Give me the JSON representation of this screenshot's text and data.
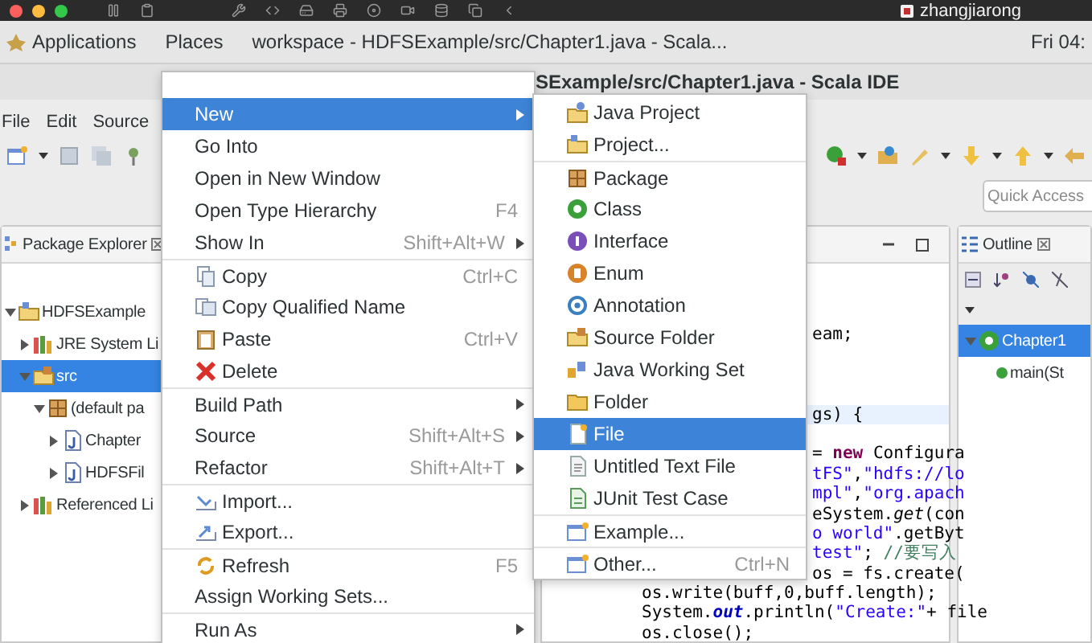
{
  "system_bar": {
    "user": "zhangjiarong"
  },
  "top_bar": {
    "applications": "Applications",
    "places": "Places",
    "window_title": "workspace - HDFSExample/src/Chapter1.java - Scala...",
    "clock": "Fri 04:"
  },
  "window": {
    "title": "SExample/src/Chapter1.java - Scala IDE"
  },
  "menu_bar": [
    "File",
    "Edit",
    "Source"
  ],
  "quick_access": {
    "placeholder": "Quick Access"
  },
  "package_explorer": {
    "title": "Package Explorer",
    "tree": [
      {
        "label": "HDFSExample",
        "kind": "project",
        "expanded": true,
        "selected": false,
        "children": [
          {
            "label": "JRE System Li",
            "kind": "library",
            "expanded": false,
            "selected": false
          },
          {
            "label": "src",
            "kind": "sourcefolder",
            "expanded": true,
            "selected": true,
            "children": [
              {
                "label": "(default pa",
                "kind": "package",
                "expanded": true,
                "selected": false,
                "children": [
                  {
                    "label": "Chapter",
                    "kind": "javafile",
                    "expanded": false,
                    "selected": false
                  },
                  {
                    "label": "HDFSFil",
                    "kind": "javafile",
                    "expanded": false,
                    "selected": false
                  }
                ]
              }
            ]
          },
          {
            "label": "Referenced Li",
            "kind": "library",
            "expanded": false,
            "selected": false
          }
        ]
      }
    ]
  },
  "editor": {
    "lines": [
      {
        "kind": "partial",
        "current": false,
        "segments": [
          {
            "kind": "plain",
            "text": "eam;"
          }
        ]
      },
      {
        "kind": "blank",
        "current": false
      },
      {
        "kind": "blank",
        "current": false
      },
      {
        "kind": "blank",
        "current": false
      },
      {
        "kind": "partial",
        "current": true,
        "segments": [
          {
            "kind": "plain",
            "text": "gs) {"
          }
        ]
      },
      {
        "kind": "blank",
        "current": false
      },
      {
        "kind": "partial",
        "current": false,
        "segments": [
          {
            "kind": "plain",
            "text": "= "
          },
          {
            "kind": "keyword",
            "text": "new"
          },
          {
            "kind": "plain",
            "text": " Configura"
          }
        ]
      },
      {
        "kind": "partial",
        "current": false,
        "segments": [
          {
            "kind": "string",
            "text": "tFS\""
          },
          {
            "kind": "plain",
            "text": ","
          },
          {
            "kind": "string",
            "text": "\"hdfs://lo"
          }
        ]
      },
      {
        "kind": "partial",
        "current": false,
        "segments": [
          {
            "kind": "string",
            "text": "mpl\""
          },
          {
            "kind": "plain",
            "text": ","
          },
          {
            "kind": "string",
            "text": "\"org.apach"
          }
        ]
      },
      {
        "kind": "partial",
        "current": false,
        "segments": [
          {
            "kind": "plain",
            "text": "eSystem."
          },
          {
            "kind": "static",
            "text": "get"
          },
          {
            "kind": "plain",
            "text": "(con"
          }
        ]
      },
      {
        "kind": "partial",
        "current": false,
        "segments": [
          {
            "kind": "string",
            "text": "o world\""
          },
          {
            "kind": "plain",
            "text": ".getByt"
          }
        ]
      },
      {
        "kind": "partial",
        "current": false,
        "segments": [
          {
            "kind": "string",
            "text": "test\""
          },
          {
            "kind": "plain",
            "text": "; "
          },
          {
            "kind": "comment",
            "text": "//要写入"
          }
        ]
      },
      {
        "kind": "partial",
        "current": false,
        "segments": [
          {
            "kind": "plain",
            "text": "os = fs.create("
          }
        ]
      },
      {
        "kind": "full",
        "current": false,
        "segments": [
          {
            "kind": "plain",
            "text": "os.write(buff,0,buff.length);"
          }
        ]
      },
      {
        "kind": "full",
        "current": false,
        "segments": [
          {
            "kind": "plain",
            "text": "System."
          },
          {
            "kind": "field",
            "text": "out"
          },
          {
            "kind": "plain",
            "text": ".println("
          },
          {
            "kind": "string",
            "text": "\"Create:\""
          },
          {
            "kind": "plain",
            "text": "+ file"
          }
        ]
      },
      {
        "kind": "full",
        "current": false,
        "segments": [
          {
            "kind": "plain",
            "text": "os.close();"
          }
        ]
      }
    ]
  },
  "outline": {
    "title": "Outline",
    "tree": [
      {
        "label": "Chapter1",
        "kind": "class",
        "expanded": true,
        "selected": true,
        "children": [
          {
            "label": "main(St",
            "kind": "method",
            "selected": false
          }
        ]
      }
    ]
  },
  "context_menu": {
    "items": [
      {
        "label": "New",
        "kind": "plain",
        "submenu": true,
        "selected": true
      },
      {
        "label": "Go Into",
        "kind": "plain",
        "selected": false
      },
      {
        "label": "Open in New Window",
        "kind": "plain",
        "selected": false
      },
      {
        "label": "Open Type Hierarchy",
        "kind": "plain",
        "shortcut": "F4",
        "selected": false
      },
      {
        "label": "Show In",
        "kind": "plain",
        "shortcut": "Shift+Alt+W",
        "submenu": true,
        "selected": false
      },
      {
        "label": "Copy",
        "kind": "copy",
        "shortcut": "Ctrl+C",
        "separator_before": true,
        "selected": false
      },
      {
        "label": "Copy Qualified Name",
        "kind": "copyname",
        "selected": false
      },
      {
        "label": "Paste",
        "kind": "paste",
        "shortcut": "Ctrl+V",
        "selected": false
      },
      {
        "label": "Delete",
        "kind": "delete",
        "selected": false
      },
      {
        "label": "Build Path",
        "kind": "plain",
        "submenu": true,
        "separator_before": true,
        "selected": false
      },
      {
        "label": "Source",
        "kind": "plain",
        "shortcut": "Shift+Alt+S",
        "submenu": true,
        "selected": false
      },
      {
        "label": "Refactor",
        "kind": "plain",
        "shortcut": "Shift+Alt+T",
        "submenu": true,
        "selected": false
      },
      {
        "label": "Import...",
        "kind": "import",
        "separator_before": true,
        "selected": false
      },
      {
        "label": "Export...",
        "kind": "export",
        "selected": false
      },
      {
        "label": "Refresh",
        "kind": "refresh",
        "shortcut": "F5",
        "separator_before": true,
        "selected": false
      },
      {
        "label": "Assign Working Sets...",
        "kind": "plain",
        "selected": false
      },
      {
        "label": "Run As",
        "kind": "plain",
        "submenu": true,
        "separator_before": true,
        "selected": false
      }
    ]
  },
  "new_submenu": {
    "items": [
      {
        "label": "Java Project",
        "kind": "javaproject",
        "selected": false
      },
      {
        "label": "Project...",
        "kind": "project",
        "selected": false
      },
      {
        "label": "Package",
        "kind": "package",
        "separator_before": true,
        "selected": false
      },
      {
        "label": "Class",
        "kind": "class",
        "selected": false
      },
      {
        "label": "Interface",
        "kind": "interface",
        "selected": false
      },
      {
        "label": "Enum",
        "kind": "enum",
        "selected": false
      },
      {
        "label": "Annotation",
        "kind": "annotation",
        "selected": false
      },
      {
        "label": "Source Folder",
        "kind": "sourcefolder",
        "selected": false
      },
      {
        "label": "Java Working Set",
        "kind": "workingset",
        "selected": false
      },
      {
        "label": "Folder",
        "kind": "folder",
        "selected": false
      },
      {
        "label": "File",
        "kind": "file",
        "selected": true
      },
      {
        "label": "Untitled Text File",
        "kind": "textfile",
        "selected": false
      },
      {
        "label": "JUnit Test Case",
        "kind": "junit",
        "selected": false
      },
      {
        "label": "Example...",
        "kind": "wizard",
        "separator_before": true,
        "selected": false
      },
      {
        "label": "Other...",
        "kind": "wizard",
        "shortcut": "Ctrl+N",
        "separator_before": true,
        "selected": false
      }
    ]
  }
}
